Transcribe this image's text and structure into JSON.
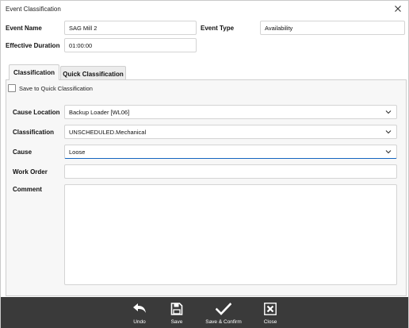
{
  "window": {
    "title": "Event Classification"
  },
  "header": {
    "event_name_label": "Event Name",
    "event_name_value": "SAG Mill 2",
    "event_type_label": "Event Type",
    "event_type_value": "Availability",
    "effective_duration_label": "Effective Duration",
    "effective_duration_value": "01:00:00"
  },
  "tabs": [
    {
      "label": "Classification",
      "active": true
    },
    {
      "label": "Quick Classification",
      "active": false
    }
  ],
  "classification": {
    "save_quick_label": "Save to Quick Classification",
    "save_quick_checked": false,
    "cause_location_label": "Cause Location",
    "cause_location_value": "Backup Loader [WL06]",
    "classification_label": "Classification",
    "classification_value": "UNSCHEDULED.Mechanical",
    "cause_label": "Cause",
    "cause_value": "Loose",
    "work_order_label": "Work Order",
    "work_order_value": "",
    "comment_label": "Comment",
    "comment_value": ""
  },
  "toolbar": {
    "undo_label": "Undo",
    "save_label": "Save",
    "save_confirm_label": "Save & Confirm",
    "close_label": "Close"
  },
  "colors": {
    "toolbar_bg": "#3a3a3a",
    "focus_accent": "#1565c0"
  }
}
